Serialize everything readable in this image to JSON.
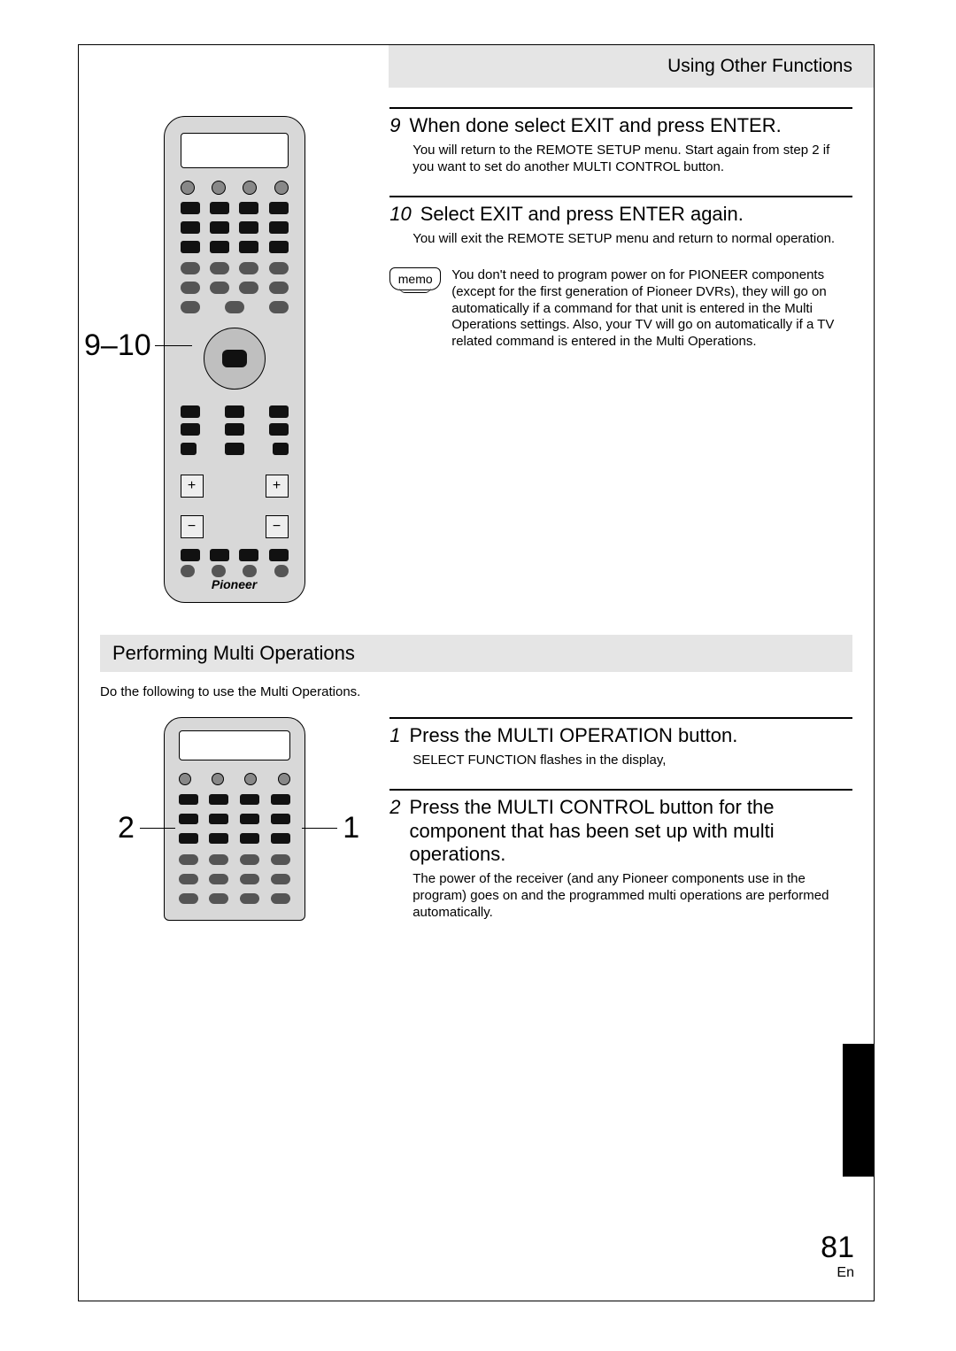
{
  "header": {
    "title": "Using Other Functions"
  },
  "figure1": {
    "callout_label": "9–10",
    "brand": "Pioneer"
  },
  "steps_top": [
    {
      "num": "9",
      "title": "When done select EXIT and press ENTER.",
      "body": "You will return to the REMOTE SETUP menu. Start again from step 2 if you want to set do another MULTI CONTROL button."
    },
    {
      "num": "10",
      "title": "Select EXIT and press ENTER again.",
      "body": "You will exit the REMOTE SETUP menu and return to normal operation."
    }
  ],
  "memo": {
    "label": "memo",
    "text": "You don't need to program power on for PIONEER  components (except for the first generation of Pioneer DVRs), they will go on automatically if a command for that unit is entered in the Multi Operations settings. Also, your TV will go on automatically if a TV related command is entered in the Multi Operations."
  },
  "section2": {
    "heading": "Performing Multi Operations",
    "intro": "Do the following to use the Multi Operations."
  },
  "figure2": {
    "callout_left": "2",
    "callout_right": "1"
  },
  "steps_bottom": [
    {
      "num": "1",
      "title": "Press the MULTI OPERATION button.",
      "body": "SELECT FUNCTION flashes in the display,"
    },
    {
      "num": "2",
      "title": "Press the MULTI CONTROL button for the component that has been set up with multi operations.",
      "body": "The power of the receiver (and any Pioneer components use in the program) goes on and the programmed multi operations are performed automatically."
    }
  ],
  "page": {
    "number": "81",
    "lang": "En"
  }
}
